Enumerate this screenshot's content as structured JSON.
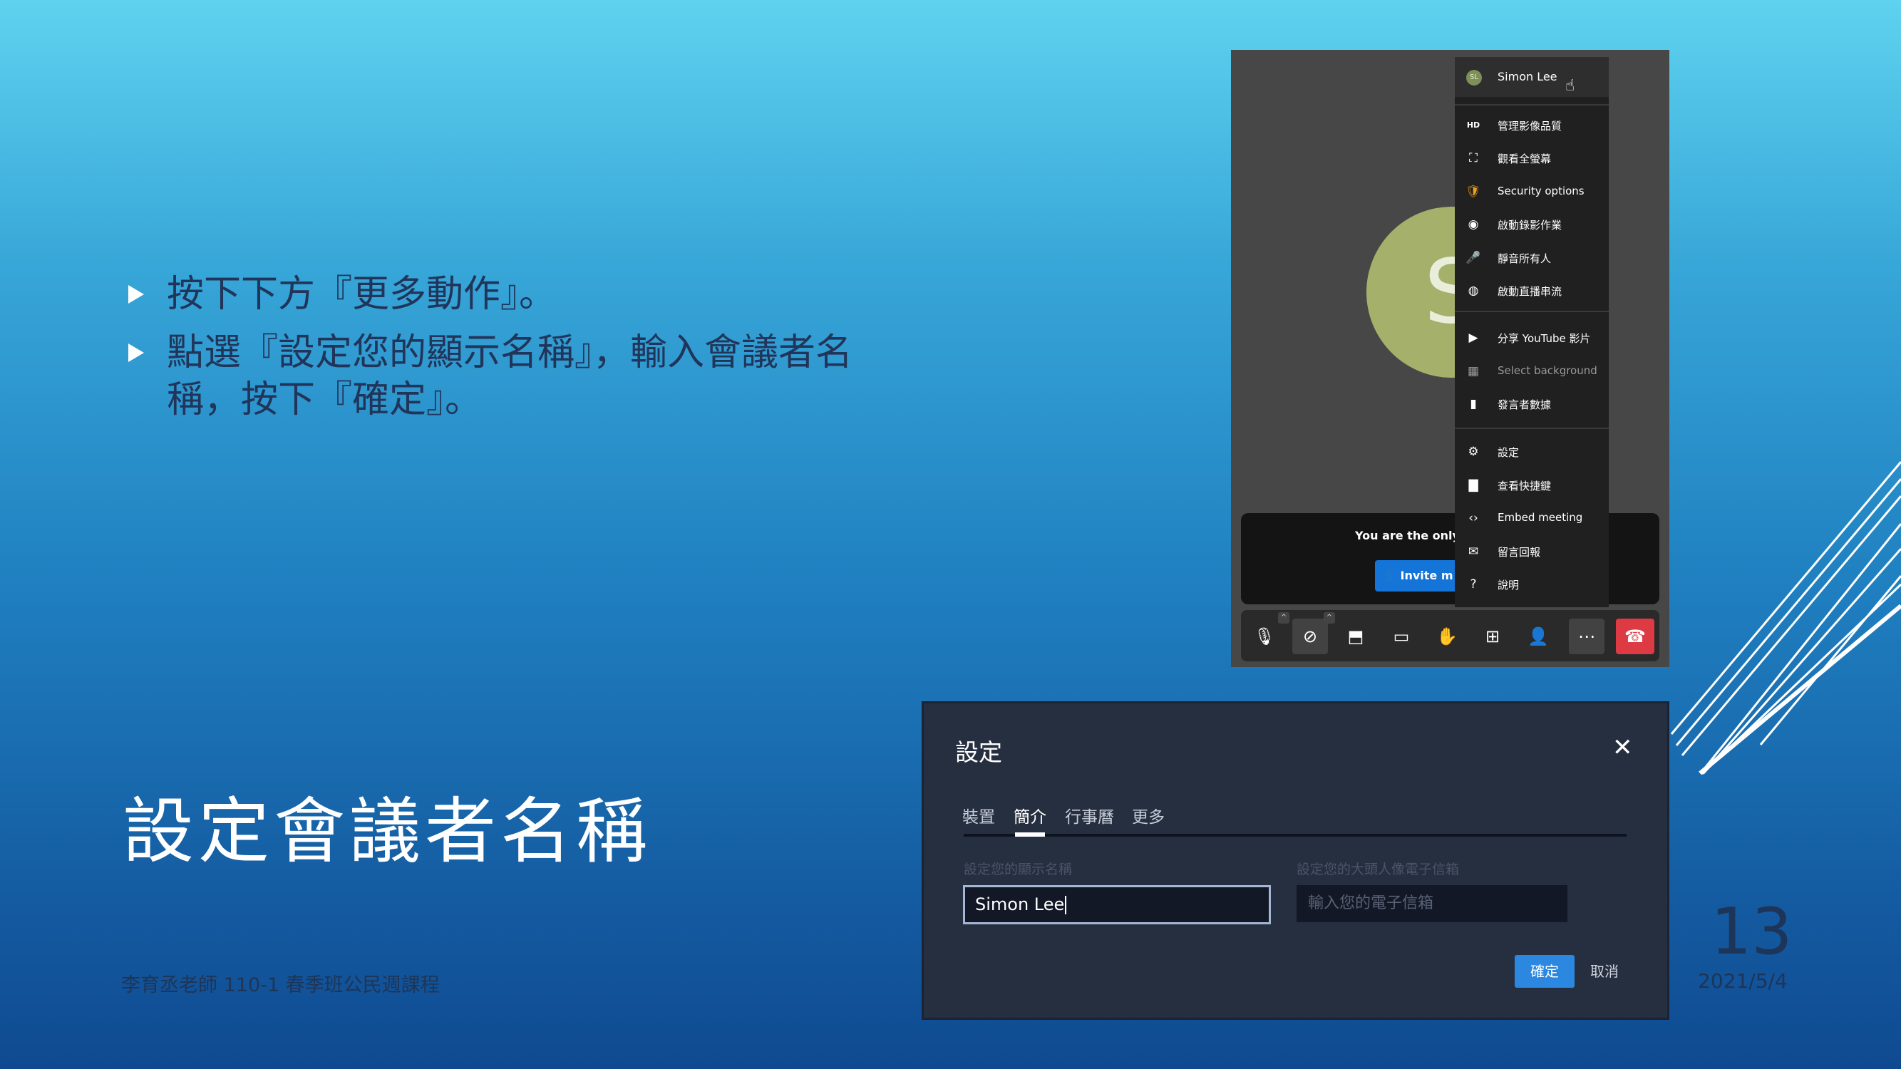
{
  "slide": {
    "bullets": [
      "按下下方『更多動作』。",
      "點選『設定您的顯示名稱』，輸入會議者名稱，按下『確定』。"
    ],
    "title": "設定會議者名稱",
    "footer": "李育丞老師 110-1 春季班公民週課程",
    "page_number": "13",
    "date": "2021/5/4"
  },
  "meeting": {
    "avatar_letter": "S",
    "notice_text": "You are the only o",
    "invite_label": "Invite m",
    "toolbar": [
      {
        "name": "mic-muted-icon",
        "glyph": "🎙"
      },
      {
        "name": "camera-off-icon",
        "glyph": "⊘"
      },
      {
        "name": "screen-share-icon",
        "glyph": "⬒"
      },
      {
        "name": "chat-icon",
        "glyph": "▭"
      },
      {
        "name": "raise-hand-icon",
        "glyph": "✋"
      },
      {
        "name": "tile-view-icon",
        "glyph": "⊞"
      },
      {
        "name": "participants-icon",
        "glyph": "👤"
      },
      {
        "name": "more-actions-icon",
        "glyph": "⋯"
      },
      {
        "name": "hangup-icon",
        "glyph": "☎"
      }
    ],
    "menu": {
      "user_initials": "SL",
      "user_name": "Simon Lee",
      "items": [
        {
          "name": "manage-video-quality",
          "icon": "hd-icon",
          "glyph": "HD",
          "label": "管理影像品質"
        },
        {
          "name": "fullscreen",
          "icon": "fullscreen-icon",
          "glyph": "⛶",
          "label": "觀看全螢幕"
        },
        {
          "name": "security-options",
          "icon": "shield-icon",
          "glyph": "🛡",
          "label": "Security options"
        },
        {
          "name": "start-recording",
          "icon": "record-icon",
          "glyph": "◉",
          "label": "啟動錄影作業"
        },
        {
          "name": "mute-everyone",
          "icon": "mute-all-icon",
          "glyph": "🎤",
          "label": "靜音所有人"
        },
        {
          "name": "start-live-stream",
          "icon": "live-stream-icon",
          "glyph": "◍",
          "label": "啟動直播串流"
        },
        {
          "name": "share-youtube",
          "icon": "play-circle-icon",
          "glyph": "▶",
          "label": "分享 YouTube 影片"
        },
        {
          "name": "select-background",
          "icon": "background-icon",
          "glyph": "▦",
          "label": "Select background"
        },
        {
          "name": "speaker-stats",
          "icon": "stats-icon",
          "glyph": "▮",
          "label": "發言者數據"
        },
        {
          "name": "settings",
          "icon": "gear-icon",
          "glyph": "⚙",
          "label": "設定"
        },
        {
          "name": "keyboard-shortcuts",
          "icon": "document-icon",
          "glyph": "▇",
          "label": "查看快捷鍵"
        },
        {
          "name": "embed-meeting",
          "icon": "code-icon",
          "glyph": "‹›",
          "label": "Embed meeting"
        },
        {
          "name": "leave-feedback",
          "icon": "feedback-icon",
          "glyph": "✉",
          "label": "留言回報"
        },
        {
          "name": "help",
          "icon": "help-icon",
          "glyph": "?",
          "label": "說明"
        }
      ]
    }
  },
  "settings_dialog": {
    "title": "設定",
    "close_glyph": "✕",
    "tabs": [
      "裝置",
      "簡介",
      "行事曆",
      "更多"
    ],
    "active_tab": "簡介",
    "display_name_label": "設定您的顯示名稱",
    "display_name_value": "Simon Lee",
    "email_label": "設定您的大頭人像電子信箱",
    "email_placeholder": "輸入您的電子信箱",
    "ok_label": "確定",
    "cancel_label": "取消"
  }
}
